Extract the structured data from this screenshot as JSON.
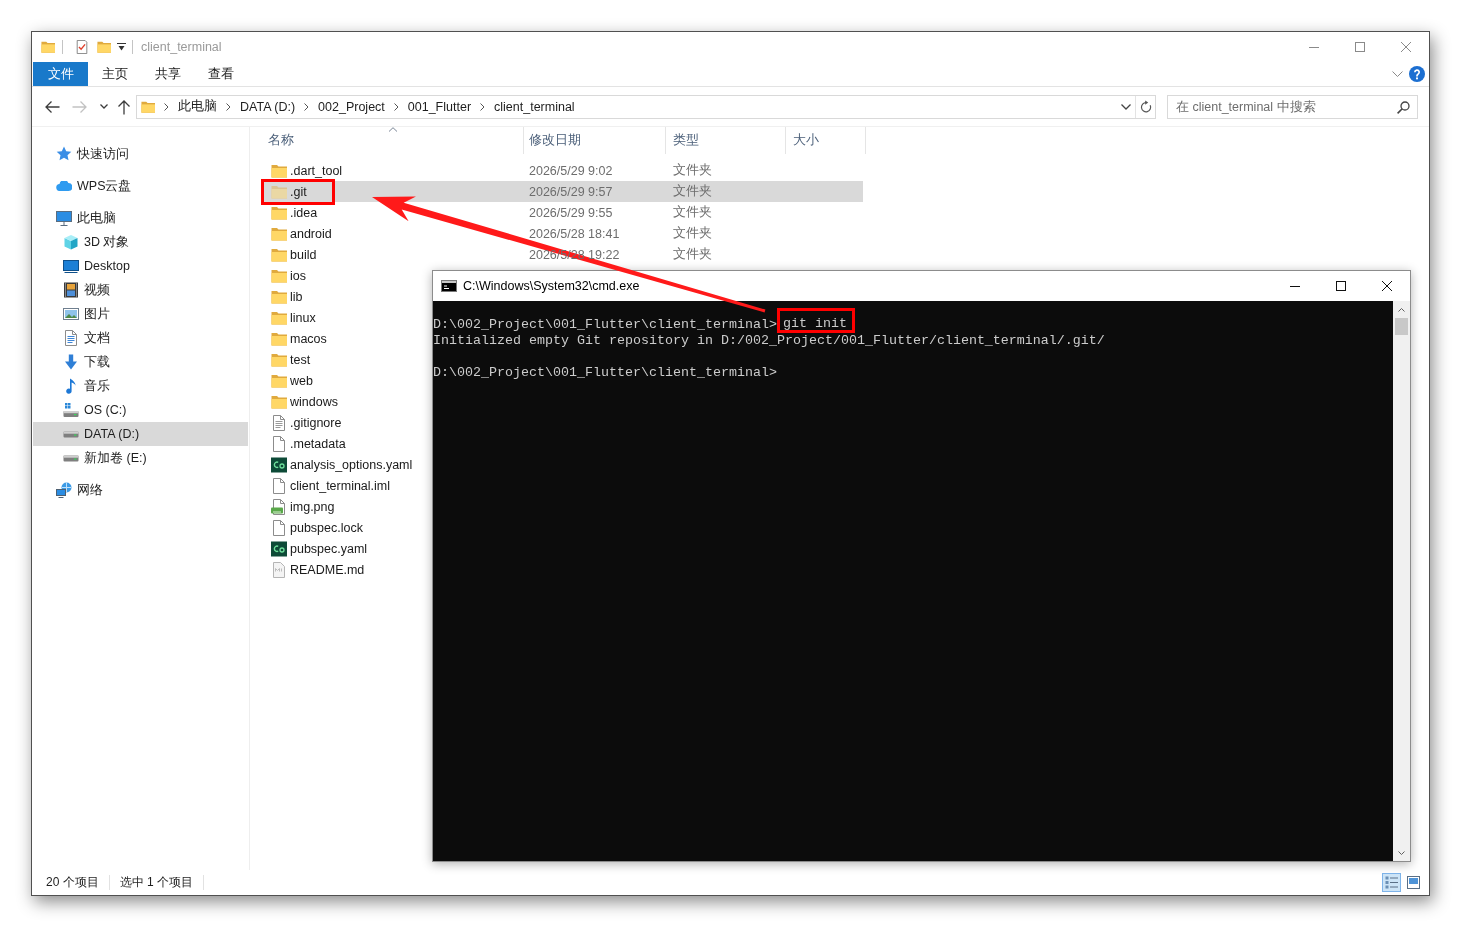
{
  "window": {
    "title": "client_terminal"
  },
  "ribbon": {
    "tabs": [
      {
        "label": "文件",
        "kind": "menu"
      },
      {
        "label": "主页",
        "kind": "tab"
      },
      {
        "label": "共享",
        "kind": "tab"
      },
      {
        "label": "查看",
        "kind": "tab"
      }
    ]
  },
  "navigation": [
    {
      "kind": "back",
      "disabled": false
    },
    {
      "kind": "forward",
      "disabled": true
    },
    {
      "kind": "recent",
      "disabled": false
    },
    {
      "kind": "up",
      "disabled": false
    }
  ],
  "address_bar": {
    "crumbs": [
      "此电脑",
      "DATA (D:)",
      "002_Project",
      "001_Flutter",
      "client_terminal"
    ]
  },
  "search": {
    "placeholder": "在 client_terminal 中搜索"
  },
  "sidebar": {
    "items": [
      {
        "label": "快速访问",
        "kind": "star",
        "selected": false
      },
      {
        "label": "WPS云盘",
        "kind": "cloud",
        "selected": false
      },
      {
        "label": "此电脑",
        "kind": "computer",
        "selected": false,
        "children": [
          {
            "label": "3D 对象",
            "kind": "cube",
            "selected": false
          },
          {
            "label": "Desktop",
            "kind": "desktop",
            "selected": false
          },
          {
            "label": "视频",
            "kind": "video",
            "selected": false
          },
          {
            "label": "图片",
            "kind": "picture",
            "selected": false
          },
          {
            "label": "文档",
            "kind": "document",
            "selected": false
          },
          {
            "label": "下载",
            "kind": "download",
            "selected": false
          },
          {
            "label": "音乐",
            "kind": "music",
            "selected": false
          },
          {
            "label": "OS (C:)",
            "kind": "system_drive",
            "selected": false
          },
          {
            "label": "DATA (D:)",
            "kind": "drive",
            "selected": true
          },
          {
            "label": "新加卷 (E:)",
            "kind": "drive",
            "selected": false
          }
        ]
      },
      {
        "label": "网络",
        "kind": "network",
        "selected": false
      }
    ]
  },
  "file_list": {
    "columns": [
      {
        "label": "名称",
        "sorted": true
      },
      {
        "label": "修改日期",
        "sorted": false
      },
      {
        "label": "类型",
        "sorted": false
      },
      {
        "label": "大小",
        "sorted": false
      }
    ],
    "rows": [
      {
        "name": ".dart_tool",
        "kind": "folder",
        "date": "2026/5/29 9:02",
        "type": "文件夹",
        "selected": false,
        "hidden": false,
        "outlined": false
      },
      {
        "name": ".git",
        "kind": "folder",
        "date": "2026/5/29 9:57",
        "type": "文件夹",
        "selected": true,
        "hidden": true,
        "outlined": true
      },
      {
        "name": ".idea",
        "kind": "folder",
        "date": "2026/5/29 9:55",
        "type": "文件夹",
        "selected": false,
        "hidden": false,
        "outlined": false
      },
      {
        "name": "android",
        "kind": "folder",
        "date": "2026/5/28 18:41",
        "type": "文件夹",
        "selected": false,
        "hidden": false,
        "outlined": false
      },
      {
        "name": "build",
        "kind": "folder",
        "date": "2026/5/28 19:22",
        "type": "文件夹",
        "selected": false,
        "hidden": false,
        "outlined": false
      },
      {
        "name": "ios",
        "kind": "folder",
        "selected": false,
        "hidden": false,
        "outlined": false
      },
      {
        "name": "lib",
        "kind": "folder",
        "selected": false,
        "hidden": false,
        "outlined": false
      },
      {
        "name": "linux",
        "kind": "folder",
        "selected": false,
        "hidden": false,
        "outlined": false
      },
      {
        "name": "macos",
        "kind": "folder",
        "selected": false,
        "hidden": false,
        "outlined": false
      },
      {
        "name": "test",
        "kind": "folder",
        "selected": false,
        "hidden": false,
        "outlined": false
      },
      {
        "name": "web",
        "kind": "folder",
        "selected": false,
        "hidden": false,
        "outlined": false
      },
      {
        "name": "windows",
        "kind": "folder",
        "selected": false,
        "hidden": false,
        "outlined": false
      },
      {
        "name": ".gitignore",
        "kind": "text",
        "selected": false,
        "hidden": false,
        "outlined": false
      },
      {
        "name": ".metadata",
        "kind": "file",
        "selected": false,
        "hidden": false,
        "outlined": false
      },
      {
        "name": "analysis_options.yaml",
        "kind": "yaml",
        "selected": false,
        "hidden": false,
        "outlined": false
      },
      {
        "name": "client_terminal.iml",
        "kind": "file",
        "selected": false,
        "hidden": false,
        "outlined": false
      },
      {
        "name": "img.png",
        "kind": "image",
        "selected": false,
        "hidden": false,
        "outlined": false
      },
      {
        "name": "pubspec.lock",
        "kind": "file",
        "selected": false,
        "hidden": false,
        "outlined": false
      },
      {
        "name": "pubspec.yaml",
        "kind": "yaml",
        "selected": false,
        "hidden": false,
        "outlined": false
      },
      {
        "name": "README.md",
        "kind": "markdown",
        "selected": false,
        "hidden": false,
        "outlined": false
      }
    ]
  },
  "status_bar": {
    "items": [
      "20 个项目",
      "选中 1 个项目"
    ],
    "views": [
      {
        "kind": "details",
        "selected": true
      },
      {
        "kind": "large_icons",
        "selected": false
      }
    ]
  },
  "terminal": {
    "title": "C:\\Windows\\System32\\cmd.exe",
    "entries": [
      {
        "prompt": "D:\\002_Project\\001_Flutter\\client_terminal>",
        "command": "git init",
        "outlined": true,
        "output": [
          "Initialized empty Git repository in D:/002_Project/001_Flutter/client_terminal/.git/"
        ]
      },
      {
        "prompt": "D:\\002_Project\\001_Flutter\\client_terminal>"
      }
    ]
  }
}
